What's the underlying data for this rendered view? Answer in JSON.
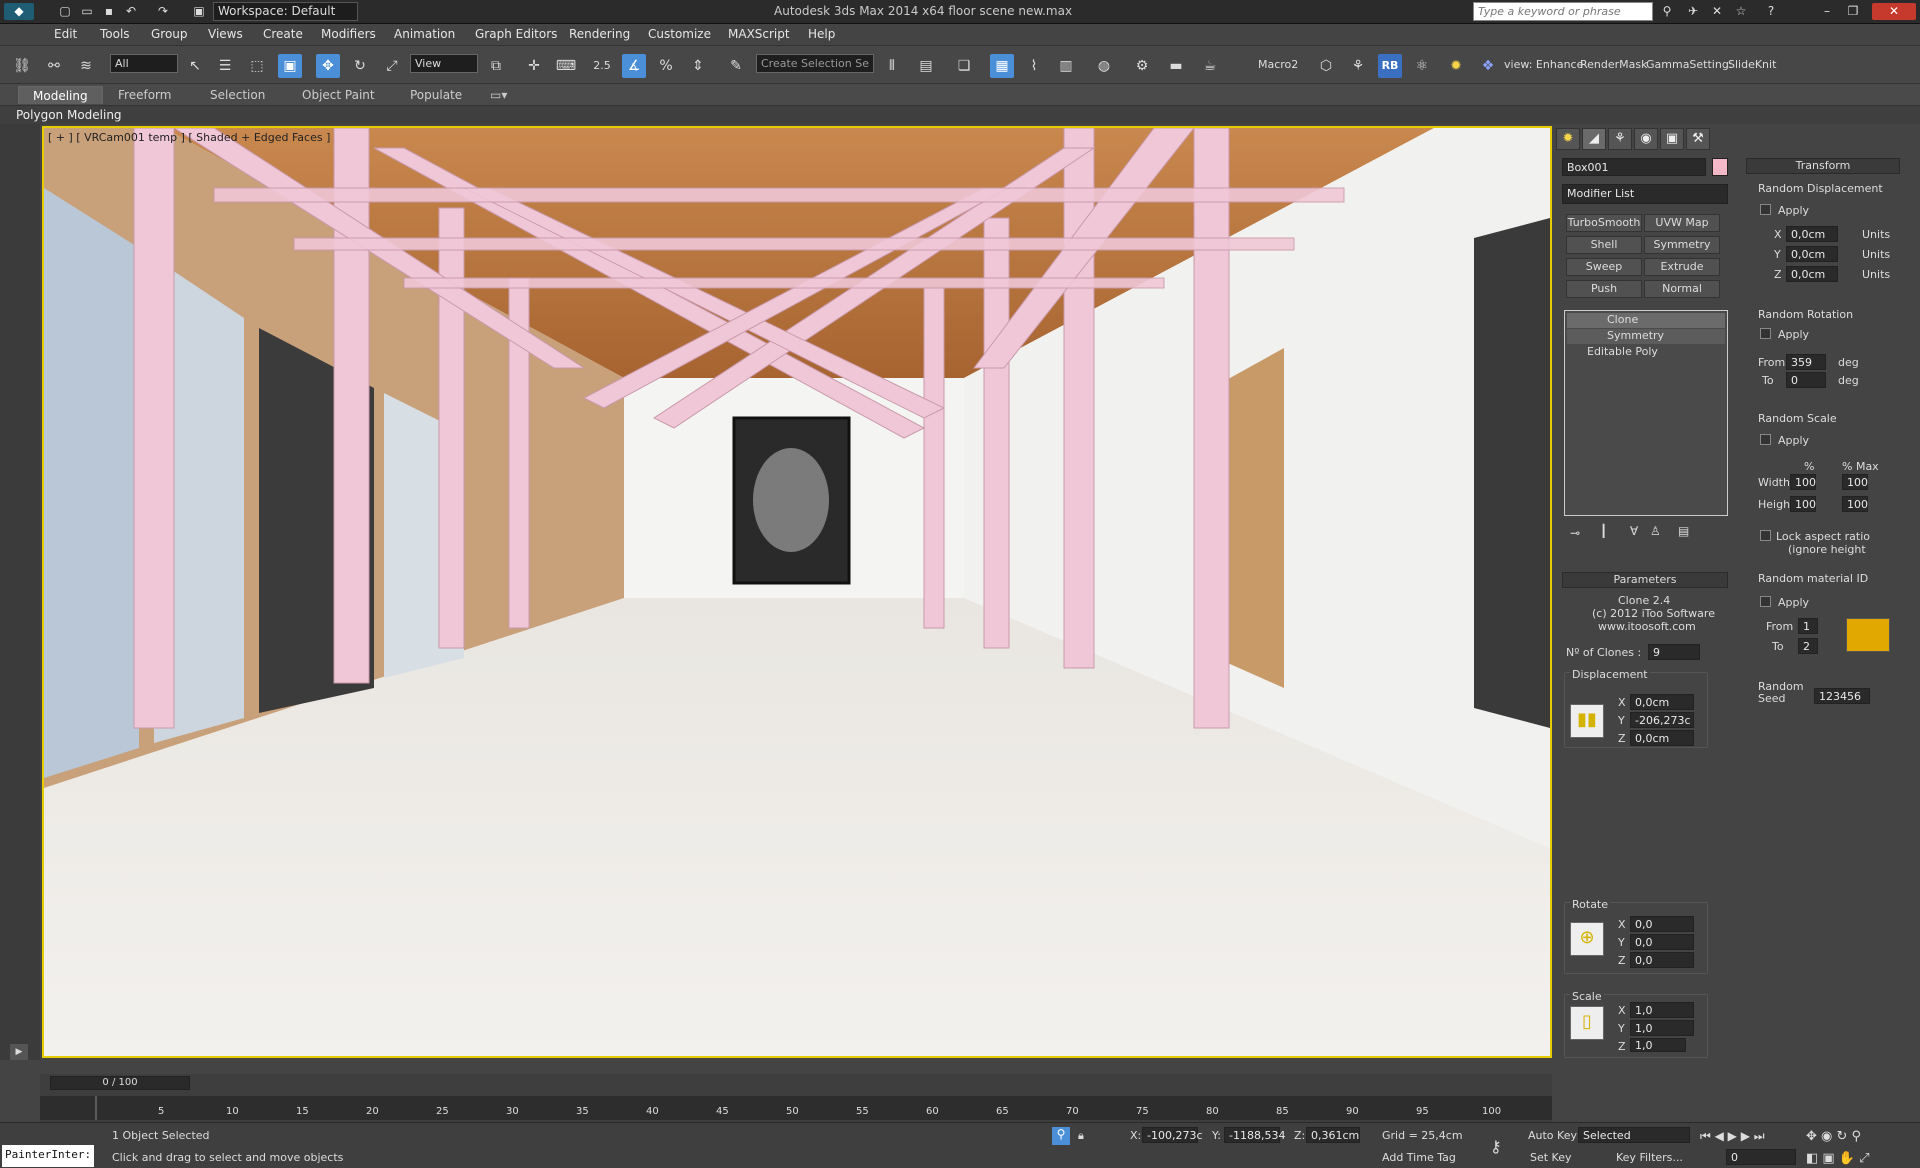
{
  "app": {
    "workspace": "Workspace: Default",
    "title": "Autodesk 3ds Max  2014 x64     floor scene new.max",
    "search_placeholder": "Type a keyword or phrase"
  },
  "menu": [
    "Edit",
    "Tools",
    "Group",
    "Views",
    "Create",
    "Modifiers",
    "Animation",
    "Graph Editors",
    "Rendering",
    "Customize",
    "MAXScript",
    "Help"
  ],
  "toolbar": {
    "selection_filter": "All",
    "ref_coord": "View",
    "snap_value": "2.5",
    "named_selection": "Create Selection Se",
    "scripts": [
      "Macro2",
      "view: Enhance",
      "RenderMask",
      "GammaSetting:",
      "SlideKnit"
    ]
  },
  "ribbon": {
    "tabs": [
      "Modeling",
      "Freeform",
      "Selection",
      "Object Paint",
      "Populate"
    ],
    "sub": "Polygon Modeling"
  },
  "viewport": {
    "label": "[ + ] [ VRCam001 temp ] [ Shaded + Edged Faces ]"
  },
  "modify": {
    "object_name": "Box001",
    "modifier_list": "Modifier List",
    "buttons": [
      "TurboSmooth",
      "UVW Map",
      "Shell",
      "Symmetry",
      "Sweep",
      "Extrude",
      "Push",
      "Normal"
    ],
    "stack": [
      "Clone",
      "Symmetry",
      "Editable Poly"
    ],
    "parameters": {
      "header": "Parameters",
      "version": "Clone 2.4",
      "copyright": "(c) 2012 iToo Software",
      "url": "www.itoosoft.com",
      "clones_label": "Nº of Clones :",
      "clones": "9",
      "displacement": {
        "label": "Displacement",
        "x": "0,0cm",
        "y": "-206,273c",
        "z": "0,0cm"
      },
      "rotate": {
        "label": "Rotate",
        "x": "0,0",
        "y": "0,0",
        "z": "0,0"
      },
      "scale": {
        "label": "Scale",
        "x": "1,0",
        "y": "1,0",
        "z": "1,0"
      }
    }
  },
  "transform": {
    "header": "Transform",
    "random_displacement": {
      "label": "Random Displacement",
      "apply": "Apply",
      "x": "0,0cm",
      "y": "0,0cm",
      "z": "0,0cm",
      "units": "Units"
    },
    "random_rotation": {
      "label": "Random Rotation",
      "apply": "Apply",
      "from_label": "From",
      "from": "359",
      "to_label": "To",
      "to": "0",
      "unit": "deg"
    },
    "random_scale": {
      "label": "Random Scale",
      "apply": "Apply",
      "pct": "%",
      "pct_max": "% Max",
      "width_label": "Width",
      "width": "100",
      "width_max": "100",
      "height_label": "Height",
      "height": "100",
      "height_max": "100",
      "lock": "Lock aspect ratio",
      "lock2": "(ignore height"
    },
    "random_material": {
      "label": "Random material ID",
      "apply": "Apply",
      "from_label": "From",
      "from": "1",
      "to_label": "To",
      "to": "2"
    },
    "seed_label": "Random",
    "seed_label2": "Seed",
    "seed": "123456"
  },
  "timeline": {
    "frame": "0 / 100",
    "ticks": [
      "5",
      "10",
      "15",
      "20",
      "25",
      "30",
      "35",
      "40",
      "45",
      "50",
      "55",
      "60",
      "65",
      "70",
      "75",
      "80",
      "85",
      "90",
      "95",
      "100"
    ]
  },
  "status": {
    "selected": "1 Object Selected",
    "prompt": "Click and drag to select and move objects",
    "x_label": "X:",
    "x": "-100,273c",
    "y_label": "Y:",
    "y": "-1188,534",
    "z_label": "Z:",
    "z": "0,361cm",
    "grid": "Grid = 25,4cm",
    "add_time_tag": "Add Time Tag",
    "auto_key": "Auto Key",
    "set_key": "Set Key",
    "key_mode": "Selected",
    "key_filters": "Key Filters...",
    "frame_field": "0",
    "script_listener": "PainterInter:"
  },
  "colors": {
    "accent": "#4b8fd8",
    "viewport_border": "#e7cc00",
    "clone_pink": "#f0c7d6",
    "object_color": "#f4b8c9"
  }
}
